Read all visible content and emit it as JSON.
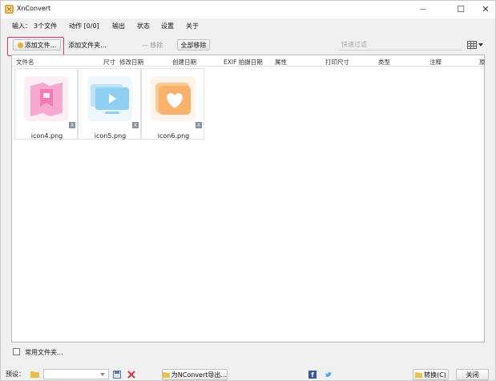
{
  "window": {
    "title": "XnConvert",
    "minimize_glyph": "—",
    "maximize_glyph": "☐",
    "close_glyph": "✕"
  },
  "menu": {
    "input_label": "输入：",
    "file_count": "3个文件",
    "actions": "动作 [0/0]",
    "output": "输出",
    "status": "状态",
    "settings": "设置",
    "about": "关于"
  },
  "toolbar": {
    "add_files": "添加文件...",
    "add_folder": "添加文件夹...",
    "remove": "— 移除",
    "remove_all": "全部移除",
    "search_placeholder": "快速过滤",
    "view_icon": "grid-view-icon"
  },
  "columns": [
    "文件名",
    "尺寸",
    "修改日期",
    "创建日期",
    "EXIF 拍摄日期",
    "属性",
    "打印尺寸",
    "类型",
    "注释",
    "原"
  ],
  "files": [
    {
      "name": "icon4.png",
      "icon": "bookmark-picture-icon",
      "color_a": "#f7a8cf",
      "color_b": "#fbd7ea"
    },
    {
      "name": "icon5.png",
      "icon": "monitor-play-icon",
      "color_a": "#8fcff3",
      "color_b": "#d7eefb"
    },
    {
      "name": "icon6.png",
      "icon": "heart-picture-icon",
      "color_a": "#f9b26b",
      "color_b": "#fde0c2"
    }
  ],
  "thumb_badge": "X",
  "favorites": {
    "label": "常用文件夹..."
  },
  "bottom": {
    "preset_label": "预设：",
    "export_label": "为NConvert导出...",
    "convert_label": "转换(C)",
    "close_label": "关闭"
  },
  "colors": {
    "highlight_border": "#d6335e",
    "facebook": "#3b5998",
    "twitter": "#4aa3df"
  }
}
